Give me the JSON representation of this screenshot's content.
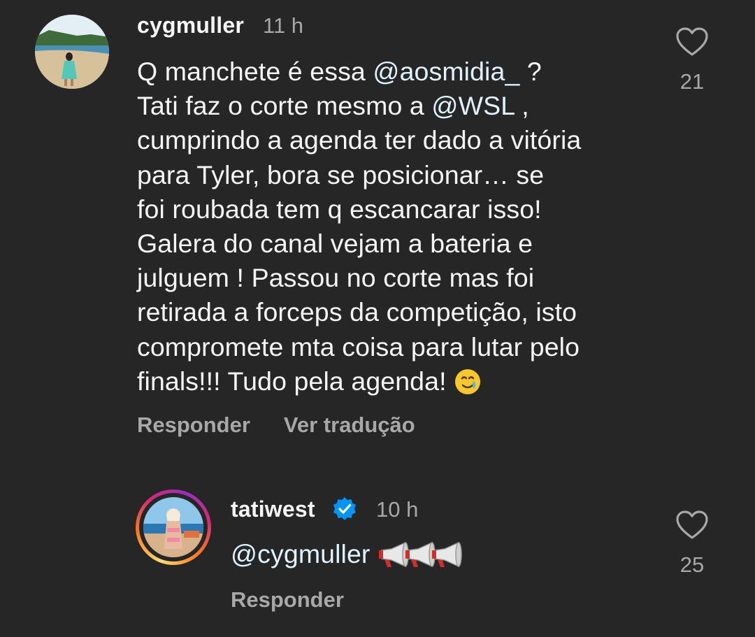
{
  "comments": [
    {
      "username": "cygmuller",
      "time": "11 h",
      "lines": [
        "Q manchete é essa ",
        "Tati faz o corte mesmo a ",
        "cumprindo a agenda ter dado a vitória",
        "para Tyler, bora se posicionar… se",
        "foi roubada tem q escancarar isso!",
        "Galera do canal vejam a bateria e",
        "julguem ! Passou no corte mas foi",
        "retirada a forceps da competição, isto",
        "compromete mta coisa para lutar pelo",
        "finals!!! Tudo pela agenda! "
      ],
      "mention1": "@aosmidia_",
      "mention1_suffix": " ?",
      "mention2": "@WSL",
      "mention2_suffix": " ,",
      "emoji": "smiling-face-with-tear",
      "reply_label": "Responder",
      "translate_label": "Ver tradução",
      "likes": "21"
    },
    {
      "username": "tatiwest",
      "verified": true,
      "time": "10 h",
      "mention": "@cygmuller",
      "emoji": "megaphone x3",
      "reply_label": "Responder",
      "likes": "25"
    }
  ],
  "colors": {
    "background": "#262626",
    "verified": "#0095f6",
    "secondary_text": "#a8a8a8"
  }
}
